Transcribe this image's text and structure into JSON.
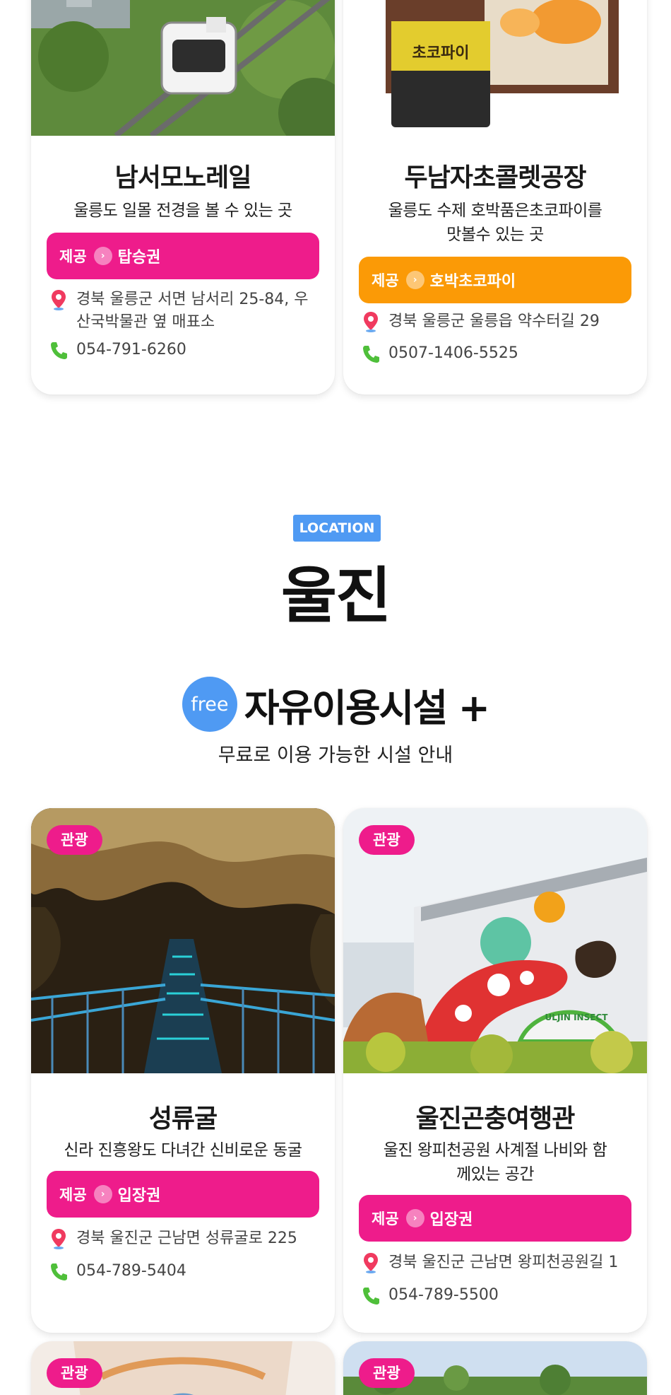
{
  "top_cards": [
    {
      "title": "남서모노레일",
      "desc": "울릉도 일몰 전경을 볼 수 있는 곳",
      "offer_label": "제공",
      "offer_item": "탑승권",
      "address": "경북 울릉군 서면 남서리 25-84, 우산국박물관 옆 매표소",
      "phone": "054-791-6260"
    },
    {
      "title": "두남자초콜렛공장",
      "desc": "울릉도 수제 호박품은초코파이를 맛볼수 있는 곳",
      "offer_label": "제공",
      "offer_item": "호박초코파이",
      "address": "경북 울릉군 울릉읍 약수터길 29",
      "phone": "0507-1406-5525",
      "product_label": "초코파이"
    }
  ],
  "section": {
    "badge": "LOCATION",
    "title": "울진",
    "free_badge": "free",
    "heading": "자유이용시설 +",
    "subheading": "무료로 이용 가능한 시설 안내"
  },
  "cards": [
    {
      "tag": "관광",
      "title": "성류굴",
      "desc": "신라 진흥왕도 다녀간 신비로운 동굴",
      "offer_label": "제공",
      "offer_item": "입장권",
      "address": "경북 울진군 근남면 성류굴로 225",
      "phone": "054-789-5404"
    },
    {
      "tag": "관광",
      "title": "울진곤충여행관",
      "desc": "울진 왕피천공원 사계절 나비와 함께있는 공간",
      "offer_label": "제공",
      "offer_item": "입장권",
      "address": "경북 울진군 근남면 왕피천공원길 1",
      "phone": "054-789-5500",
      "sign_text": "ULJIN INSECT"
    },
    {
      "tag": "관광"
    },
    {
      "tag": "관광"
    }
  ],
  "colors": {
    "pink": "#ee1c8b",
    "orange": "#fb9a06",
    "blue": "#4f9af3"
  }
}
